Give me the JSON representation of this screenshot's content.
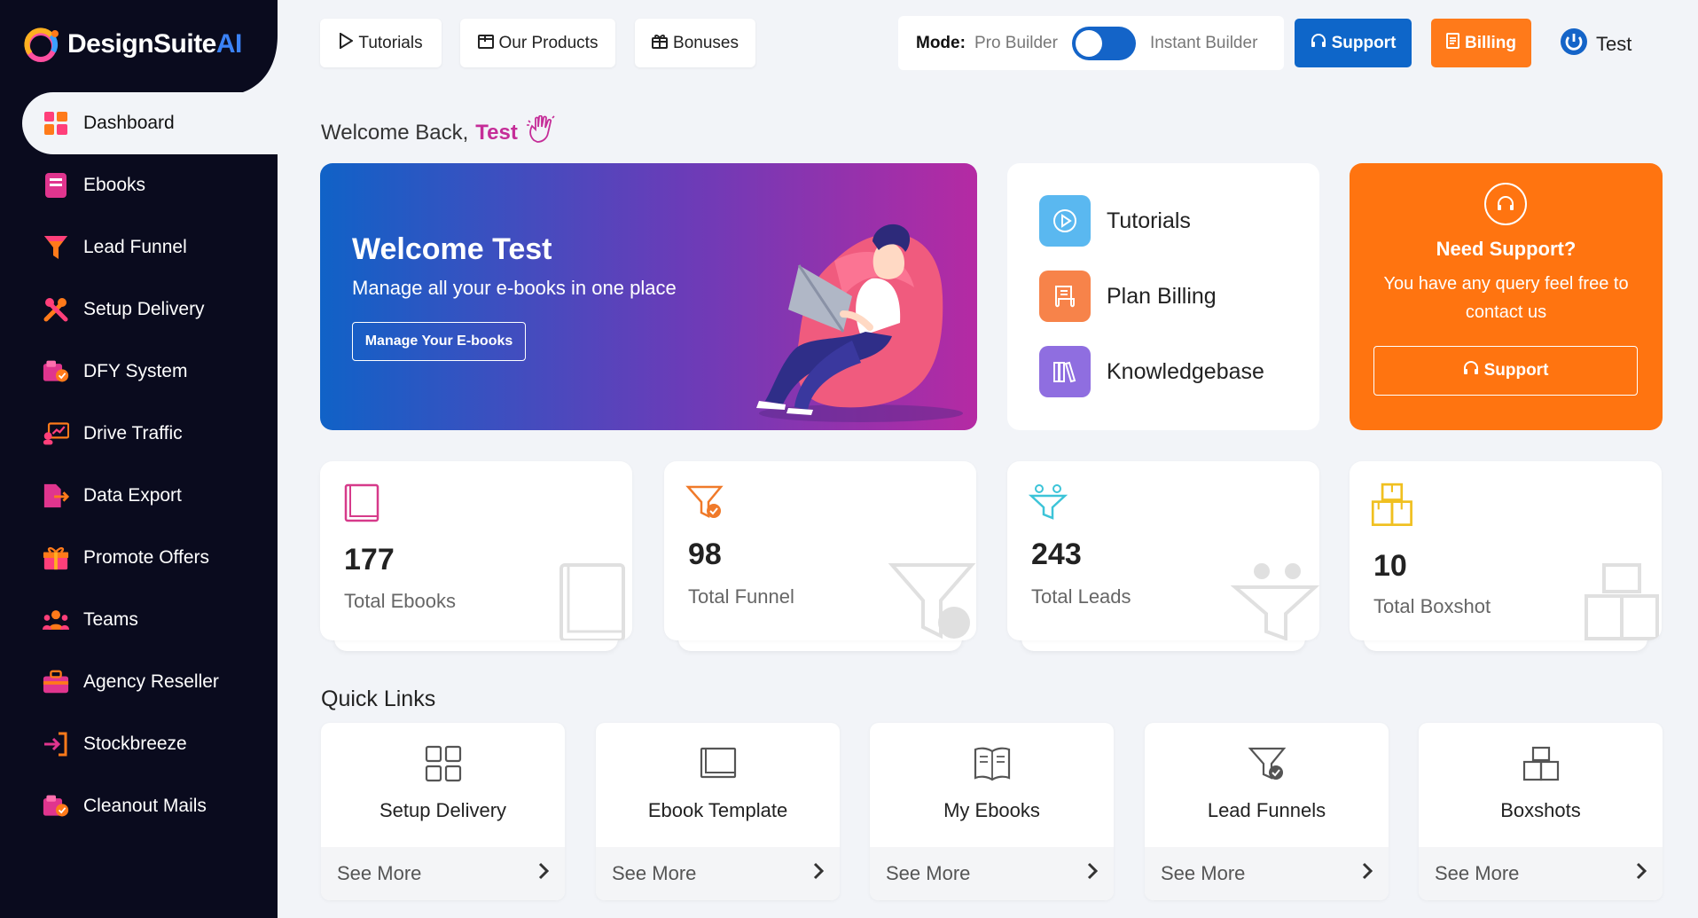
{
  "brand": {
    "name_main": "DesignSuite",
    "name_ai": "AI"
  },
  "sidebar": {
    "items": [
      {
        "label": "Dashboard",
        "icon": "dashboard-icon",
        "active": true
      },
      {
        "label": "Ebooks",
        "icon": "ebook-icon"
      },
      {
        "label": "Lead Funnel",
        "icon": "funnel-icon"
      },
      {
        "label": "Setup Delivery",
        "icon": "tools-icon"
      },
      {
        "label": "DFY System",
        "icon": "folder-check-icon"
      },
      {
        "label": "Drive Traffic",
        "icon": "traffic-icon"
      },
      {
        "label": "Data Export",
        "icon": "export-icon"
      },
      {
        "label": "Promote Offers",
        "icon": "gift-icon"
      },
      {
        "label": "Teams",
        "icon": "team-icon"
      },
      {
        "label": "Agency Reseller",
        "icon": "briefcase-icon"
      },
      {
        "label": "Stockbreeze",
        "icon": "login-arrow-icon"
      },
      {
        "label": "Cleanout Mails",
        "icon": "folder-check-icon"
      }
    ]
  },
  "topbar": {
    "tutorials": "Tutorials",
    "products": "Our Products",
    "bonuses": "Bonuses",
    "mode_label": "Mode:",
    "mode_left": "Pro Builder",
    "mode_right": "Instant Builder",
    "support": "Support",
    "billing": "Billing",
    "user": "Test"
  },
  "welcome": {
    "prefix": "Welcome Back,",
    "name": "Test"
  },
  "hero": {
    "title": "Welcome Test",
    "subtitle": "Manage all your e-books in one place",
    "button": "Manage Your E-books"
  },
  "links": [
    {
      "label": "Tutorials",
      "color": "#5ab8f0",
      "icon": "play-icon"
    },
    {
      "label": "Plan Billing",
      "color": "#f7834a",
      "icon": "receipt-icon"
    },
    {
      "label": "Knowledgebase",
      "color": "#8f6ee0",
      "icon": "books-icon"
    }
  ],
  "support_card": {
    "title": "Need Support?",
    "text": "You have any query feel free to contact us",
    "button": "Support"
  },
  "stats": [
    {
      "value": "177",
      "label": "Total Ebooks",
      "icon": "ebook-icon",
      "color": "#d63a8a"
    },
    {
      "value": "98",
      "label": "Total Funnel",
      "icon": "funnel-check-icon",
      "color": "#f07a2a"
    },
    {
      "value": "243",
      "label": "Total Leads",
      "icon": "leads-funnel-icon",
      "color": "#3cc4d8"
    },
    {
      "value": "10",
      "label": "Total Boxshot",
      "icon": "boxes-icon",
      "color": "#f0c020"
    }
  ],
  "quick_links": {
    "title": "Quick Links",
    "see_more": "See More",
    "items": [
      {
        "label": "Setup Delivery",
        "icon": "grid-icon"
      },
      {
        "label": "Ebook Template",
        "icon": "book-outline-icon"
      },
      {
        "label": "My Ebooks",
        "icon": "open-book-icon"
      },
      {
        "label": "Lead Funnels",
        "icon": "funnel-check-icon"
      },
      {
        "label": "Boxshots",
        "icon": "boxes-icon"
      }
    ]
  }
}
